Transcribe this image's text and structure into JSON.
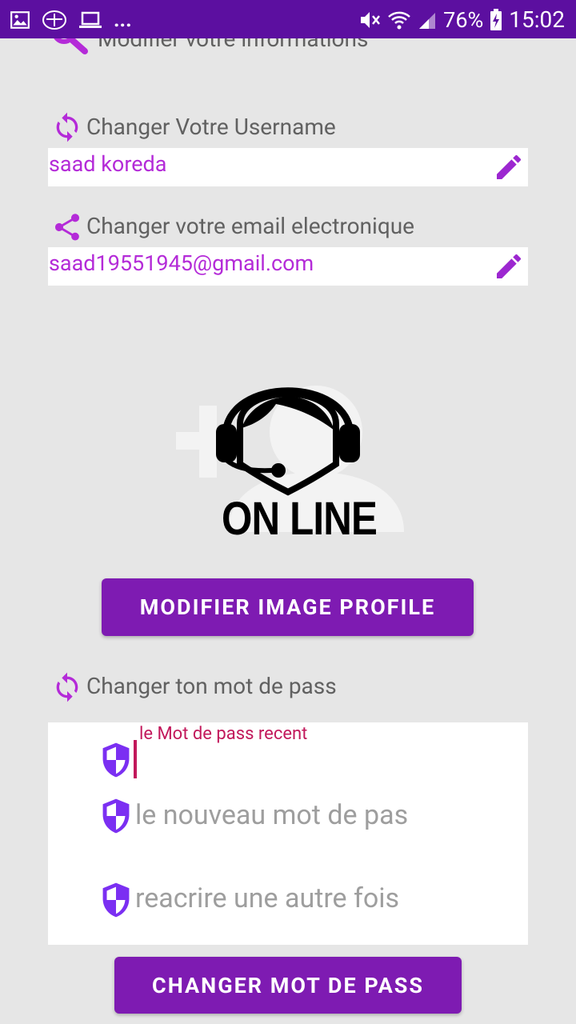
{
  "status_bar": {
    "left_icons": [
      "image-icon",
      "app-logo-icon",
      "laptop-icon"
    ],
    "overflow": "...",
    "battery": "76%",
    "time": "15:02"
  },
  "header": {
    "title": "Modifier votre informations"
  },
  "username": {
    "label": "Changer Votre Username",
    "value": "saad koreda"
  },
  "email": {
    "label": "Changer votre email electronique",
    "value": "saad19551945@gmail.com"
  },
  "profile": {
    "logo_text": "ON LINE",
    "button_label": "MODIFIER IMAGE PROFILE"
  },
  "password": {
    "section_label": "Changer ton mot de pass",
    "current_label": "le Mot de pass recent",
    "new_placeholder": "le nouveau mot de pas",
    "confirm_placeholder": "reacrire une autre fois",
    "button_label": "CHANGER MOT DE PASS"
  },
  "colors": {
    "status_bar": "#5c0fa0",
    "accent": "#b42bd8",
    "button": "#7e1bb2",
    "focus": "#c2185b"
  }
}
